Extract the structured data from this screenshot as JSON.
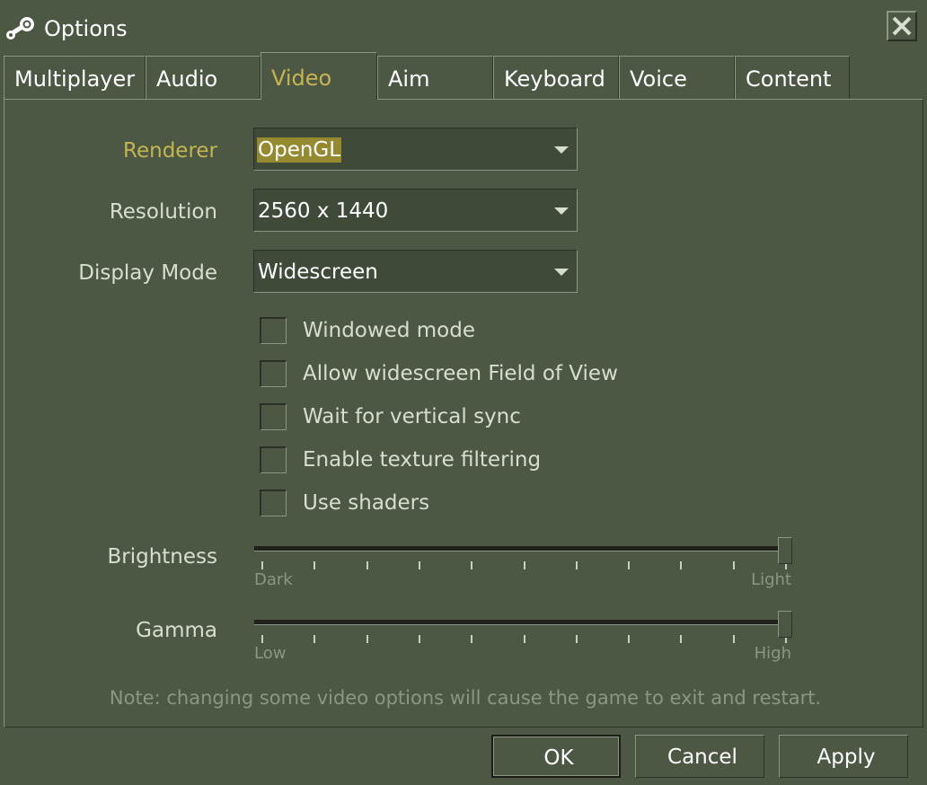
{
  "window": {
    "title": "Options",
    "icon": "steam-icon",
    "close_icon": "close-icon"
  },
  "tabs": [
    {
      "label": "Multiplayer",
      "active": false
    },
    {
      "label": "Audio",
      "active": false
    },
    {
      "label": "Video",
      "active": true
    },
    {
      "label": "Aim",
      "active": false
    },
    {
      "label": "Keyboard",
      "active": false
    },
    {
      "label": "Voice",
      "active": false
    },
    {
      "label": "Content",
      "active": false
    }
  ],
  "video": {
    "renderer": {
      "label": "Renderer",
      "value": "OpenGL"
    },
    "resolution": {
      "label": "Resolution",
      "value": "2560 x 1440"
    },
    "display_mode": {
      "label": "Display Mode",
      "value": "Widescreen"
    },
    "checkboxes": [
      {
        "label": "Windowed mode",
        "checked": false
      },
      {
        "label": "Allow widescreen Field of View",
        "checked": false
      },
      {
        "label": "Wait for vertical sync",
        "checked": false
      },
      {
        "label": "Enable texture filtering",
        "checked": false
      },
      {
        "label": "Use shaders",
        "checked": false
      }
    ],
    "brightness": {
      "label": "Brightness",
      "min_label": "Dark",
      "max_label": "Light",
      "value": 1.0
    },
    "gamma": {
      "label": "Gamma",
      "min_label": "Low",
      "max_label": "High",
      "value": 1.0
    },
    "note": "Note: changing some video options will cause the game to exit and restart."
  },
  "buttons": {
    "ok": "OK",
    "cancel": "Cancel",
    "apply": "Apply"
  },
  "colors": {
    "background": "#4c5844",
    "highlight_text": "#c4b550",
    "selection": "#958a30"
  }
}
